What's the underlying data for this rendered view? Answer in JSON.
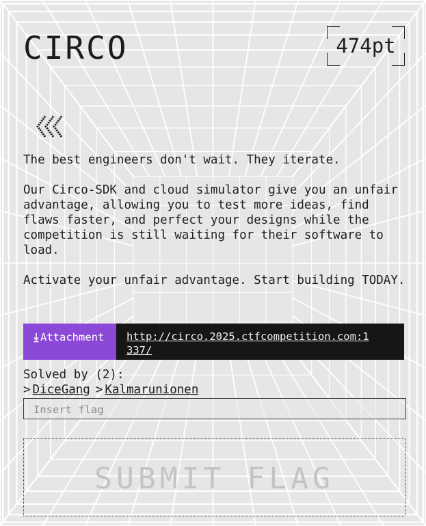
{
  "challenge": {
    "title": "CIRCO",
    "points": "474pt",
    "back_icon": "triple-chevron-left-icon",
    "description": [
      "The best engineers don't wait. They iterate.",
      "Our Circo-SDK and cloud simulator give you an unfair advantage, allowing you to test more ideas, find flaws faster, and perfect your designs while the competition is still waiting for their software to load.",
      "Activate your unfair advantage. Start building TODAY."
    ],
    "attachment": {
      "label": "Attachment",
      "icon": "download-icon",
      "url": "http://circo.2025.ctfcompetition.com:1337/"
    },
    "solved_by": {
      "label": "Solved by (2):",
      "teams": [
        "DiceGang",
        "Kalmarunionen"
      ]
    },
    "flag_input": {
      "placeholder": "Insert flag",
      "value": ""
    },
    "submit_label": "SUBMIT FLAG"
  },
  "colors": {
    "background": "#e6e6e6",
    "grid_lines": "#ffffff",
    "text": "#1e1e1e",
    "attachment_accent": "#8c49d8",
    "attachment_bg": "#161616",
    "submit_text": "#c4c4c4"
  }
}
